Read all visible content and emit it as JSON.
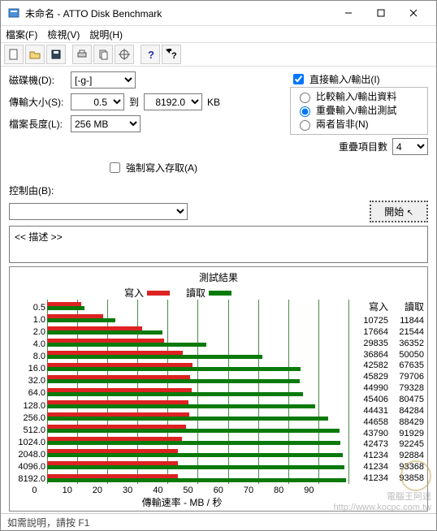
{
  "title": "未命名 - ATTO Disk Benchmark",
  "menu": {
    "file": "檔案(F)",
    "view": "檢視(V)",
    "help": "說明(H)"
  },
  "labels": {
    "drive": "磁碟機(D):",
    "drive_val": "[-g-]",
    "xfer": "傳輸大小(S):",
    "xfer_from": "0.5",
    "to": "到",
    "xfer_to": "8192.0",
    "kb": "KB",
    "len": "檔案長度(L):",
    "len_val": "256 MB",
    "force": "強制寫入存取(A)",
    "direct": "直接輸入/輸出(I)",
    "r1": "比較輸入/輸出資料",
    "r2": "重疊輸入/輸出測試",
    "r3": "兩者皆非(N)",
    "queue": "重疊項目數",
    "queue_val": "4",
    "ctrl": "控制由(B):",
    "start": "開始",
    "desc": "<<   描述    >>",
    "result": "測試結果",
    "write": "寫入",
    "read": "讀取",
    "xaxis": "傳輸速率 - MB / 秒",
    "status": "如需說明，請按 F1",
    "wm1": "電腦王阿達",
    "wm2": "http://www.kocpc.com.tw"
  },
  "chart_data": {
    "type": "bar",
    "xlabel": "傳輸速率 - MB / 秒",
    "ylabel": "",
    "xlim": [
      0,
      95
    ],
    "xticks": [
      0,
      10,
      20,
      30,
      40,
      50,
      60,
      70,
      80,
      90
    ],
    "categories": [
      "0.5",
      "1.0",
      "2.0",
      "4.0",
      "8.0",
      "16.0",
      "32.0",
      "64.0",
      "128.0",
      "256.0",
      "512.0",
      "1024.0",
      "2048.0",
      "4096.0",
      "8192.0"
    ],
    "series": [
      {
        "name": "寫入",
        "color": "#d22",
        "values": [
          10725,
          17664,
          29835,
          36864,
          42582,
          45829,
          44990,
          45406,
          44431,
          44658,
          43790,
          42473,
          41234,
          41234,
          41234
        ]
      },
      {
        "name": "讀取",
        "color": "#0a7a0a",
        "values": [
          11844,
          21544,
          36352,
          50050,
          67635,
          79706,
          79328,
          80475,
          84284,
          88429,
          91929,
          92245,
          92884,
          93368,
          93858
        ]
      }
    ],
    "display_scale_note": "values are in KB/s; bars plotted as MB/s (value/1000) against xlim 0-95"
  }
}
